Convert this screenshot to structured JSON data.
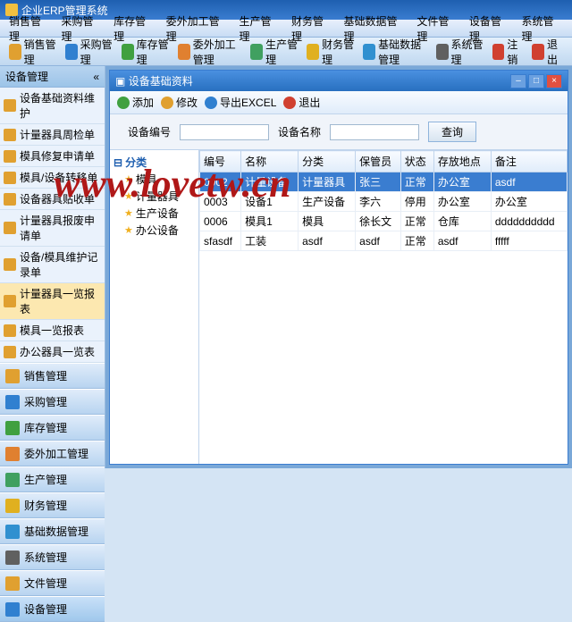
{
  "app": {
    "title": "企业ERP管理系统"
  },
  "menu": [
    "销售管理",
    "采购管理",
    "库存管理",
    "委外加工管理",
    "生产管理",
    "财务管理",
    "基础数据管理",
    "文件管理",
    "设备管理",
    "系统管理"
  ],
  "toolbar": [
    {
      "label": "销售管理",
      "color": "#e0a030"
    },
    {
      "label": "采购管理",
      "color": "#3080d0"
    },
    {
      "label": "库存管理",
      "color": "#40a040"
    },
    {
      "label": "委外加工管理",
      "color": "#e08030"
    },
    {
      "label": "生产管理",
      "color": "#40a060"
    },
    {
      "label": "财务管理",
      "color": "#e0b020"
    },
    {
      "label": "基础数据管理",
      "color": "#3090d0"
    },
    {
      "label": "系统管理",
      "color": "#606060"
    },
    {
      "label": "注销",
      "color": "#d04030"
    },
    {
      "label": "退出",
      "color": "#d04030"
    }
  ],
  "sidebar": {
    "header": "设备管理",
    "tree": [
      "设备基础资料维护",
      "计量器具周检单",
      "模具修复申请单",
      "模具/设备转移单",
      "设备器具贴收单",
      "计量器具报废申请单",
      "设备/模具维护记录单",
      "计量器具一览报表",
      "模具一览报表",
      "办公器具一览表"
    ],
    "active_tree_index": 7,
    "groups": [
      "销售管理",
      "采购管理",
      "库存管理",
      "委外加工管理",
      "生产管理",
      "财务管理",
      "基础数据管理",
      "系统管理",
      "文件管理",
      "设备管理"
    ],
    "group_colors": [
      "#e0a030",
      "#3080d0",
      "#40a040",
      "#e08030",
      "#40a060",
      "#e0b020",
      "#3090d0",
      "#606060",
      "#e0a030",
      "#3080d0"
    ],
    "active_group_index": 9
  },
  "window": {
    "title": "设备基础资料",
    "tools": [
      {
        "label": "添加",
        "color": "#40a040"
      },
      {
        "label": "修改",
        "color": "#e0a030"
      },
      {
        "label": "导出EXCEL",
        "color": "#3080d0"
      },
      {
        "label": "退出",
        "color": "#d04030"
      }
    ],
    "search": {
      "code_label": "设备编号",
      "name_label": "设备名称",
      "btn": "查询",
      "code_val": "",
      "name_val": ""
    },
    "tree": {
      "root": "分类",
      "children": [
        "模具",
        "计量器具",
        "生产设备",
        "办公设备"
      ]
    },
    "grid": {
      "headers": [
        "编号",
        "名称",
        "分类",
        "保管员",
        "状态",
        "存放地点",
        "备注"
      ],
      "rows": [
        [
          "0002",
          "计量设备",
          "计量器具",
          "张三",
          "正常",
          "办公室",
          "asdf"
        ],
        [
          "0003",
          "设备1",
          "生产设备",
          "李六",
          "停用",
          "办公室",
          "办公室"
        ],
        [
          "0006",
          "模具1",
          "模具",
          "徐长文",
          "正常",
          "仓库",
          "dddddddddd"
        ],
        [
          "sfasdf",
          "工装",
          "asdf",
          "asdf",
          "正常",
          "asdf",
          "fffff"
        ]
      ],
      "selected": 0
    }
  },
  "watermark": "www.lovetw.cn"
}
